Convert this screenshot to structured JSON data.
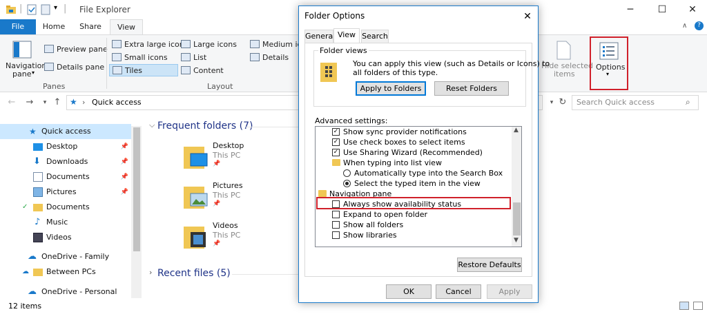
{
  "window": {
    "title": "File Explorer"
  },
  "ribbon": {
    "tabs": [
      "File",
      "Home",
      "Share",
      "View"
    ],
    "panes": {
      "navigation_pane": "Navigation",
      "navigation_pane_2": "pane",
      "preview_pane": "Preview pane",
      "details_pane": "Details pane",
      "group_label": "Panes"
    },
    "layout": {
      "items": [
        "Extra large icons",
        "Large icons",
        "Medium icons",
        "Small icons",
        "List",
        "Details",
        "Tiles",
        "Content"
      ],
      "group_label": "Layout"
    },
    "hide_selected": [
      "Hide selected",
      "items"
    ],
    "options_label": "Options"
  },
  "address": {
    "path": "Quick access",
    "search_placeholder": "Search Quick access"
  },
  "nav": {
    "items": [
      {
        "label": "Quick access",
        "icon": "star-icon",
        "pinned": false
      },
      {
        "label": "Desktop",
        "icon": "desktop-icon",
        "pinned": true
      },
      {
        "label": "Downloads",
        "icon": "download-icon",
        "pinned": true
      },
      {
        "label": "Documents",
        "icon": "documents-icon",
        "pinned": true
      },
      {
        "label": "Pictures",
        "icon": "pictures-icon",
        "pinned": true
      },
      {
        "label": "Documents",
        "icon": "folder-icon",
        "pinned": false
      },
      {
        "label": "Music",
        "icon": "music-icon",
        "pinned": false
      },
      {
        "label": "Videos",
        "icon": "videos-icon",
        "pinned": false
      },
      {
        "label": "OneDrive - Family",
        "icon": "cloud-icon",
        "pinned": false
      },
      {
        "label": "Between PCs",
        "icon": "folder-icon",
        "pinned": false
      },
      {
        "label": "OneDrive - Personal",
        "icon": "cloud-icon",
        "pinned": false
      }
    ]
  },
  "content": {
    "frequent_header": "Frequent folders (7)",
    "folders": [
      {
        "name": "Desktop",
        "location": "This PC"
      },
      {
        "name": "Pictures",
        "location": "This PC"
      },
      {
        "name": "Videos",
        "location": "This PC"
      }
    ],
    "recent_header": "Recent files (5)"
  },
  "status": {
    "items_count": "12 items"
  },
  "dialog": {
    "title": "Folder Options",
    "tabs": [
      "General",
      "View",
      "Search"
    ],
    "folder_views": {
      "legend": "Folder views",
      "description_1": "You can apply this view (such as Details or Icons) to",
      "description_2": "all folders of this type.",
      "apply_button": "Apply to Folders",
      "reset_button": "Reset Folders"
    },
    "advanced_label": "Advanced settings:",
    "advanced": [
      {
        "kind": "checkbox",
        "checked": true,
        "label": "Show sync provider notifications"
      },
      {
        "kind": "checkbox",
        "checked": true,
        "label": "Use check boxes to select items"
      },
      {
        "kind": "checkbox",
        "checked": true,
        "label": "Use Sharing Wizard (Recommended)"
      },
      {
        "kind": "folder",
        "label": "When typing into list view"
      },
      {
        "kind": "radio",
        "checked": false,
        "label": "Automatically type into the Search Box"
      },
      {
        "kind": "radio",
        "checked": true,
        "label": "Select the typed item in the view"
      },
      {
        "kind": "folder",
        "label": "Navigation pane"
      },
      {
        "kind": "checkbox",
        "checked": false,
        "label": "Always show availability status"
      },
      {
        "kind": "checkbox",
        "checked": false,
        "label": "Expand to open folder"
      },
      {
        "kind": "checkbox",
        "checked": false,
        "label": "Show all folders"
      },
      {
        "kind": "checkbox",
        "checked": false,
        "label": "Show libraries"
      }
    ],
    "restore_defaults": "Restore Defaults",
    "ok": "OK",
    "cancel": "Cancel",
    "apply": "Apply"
  },
  "colors": {
    "accent": "#1979ca",
    "highlight": "#d0202a",
    "folder": "#f0c754"
  }
}
